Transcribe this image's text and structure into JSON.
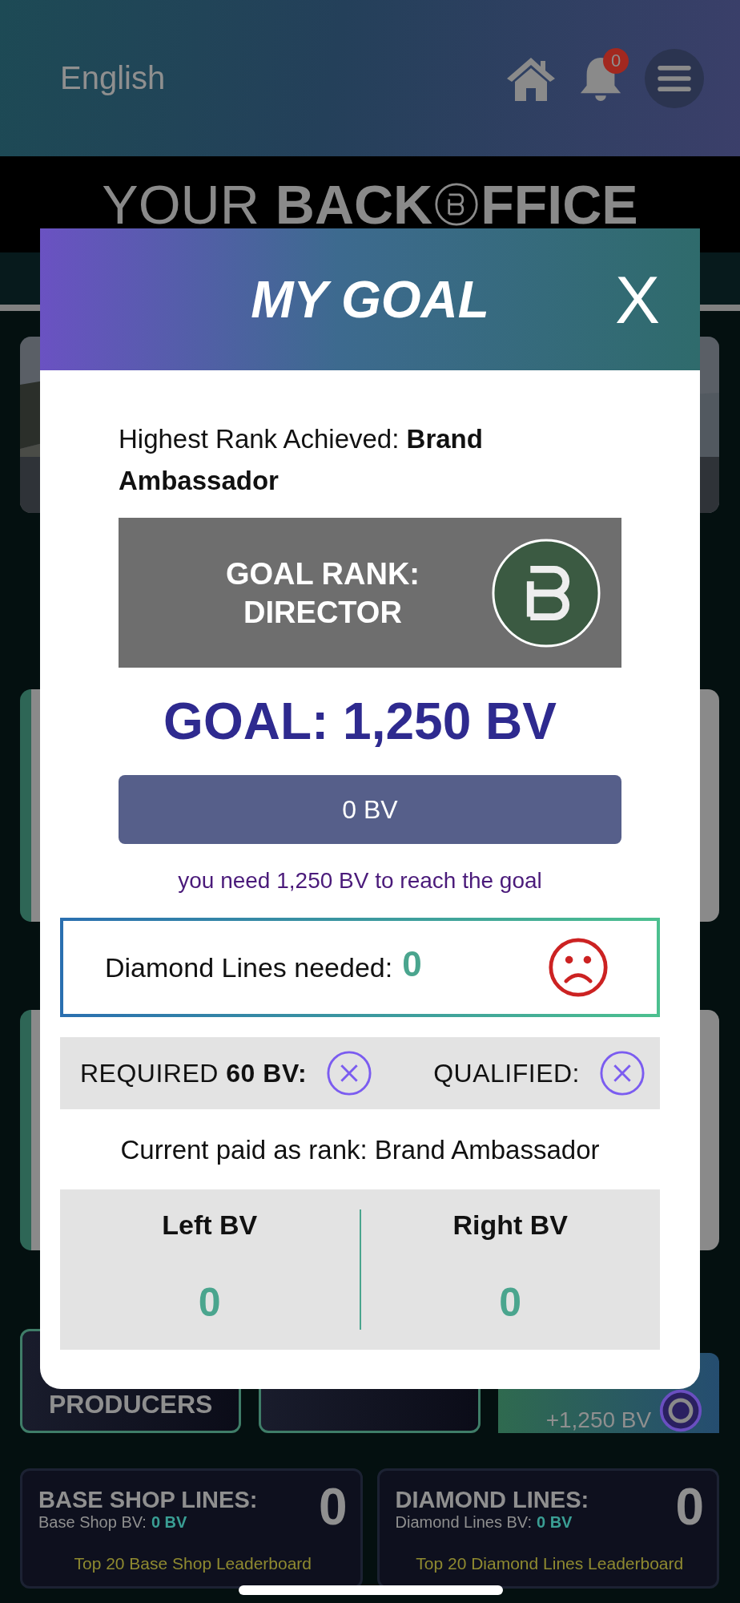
{
  "header": {
    "language": "English",
    "notification_count": "0"
  },
  "banner": {
    "light": "YOUR",
    "bold_left": "BACK",
    "bold_right": "FFICE"
  },
  "tiles": [
    {
      "kind": "outline",
      "label": "PRODUCERS"
    },
    {
      "kind": "outline"
    },
    {
      "kind": "goal",
      "label": "+1,250 BV"
    }
  ],
  "line_cards": [
    {
      "title": "BASE SHOP LINES:",
      "count": "0",
      "bv_label": "Base Shop BV:",
      "bv_value": "0 BV",
      "link": "Top 20 Base Shop Leaderboard"
    },
    {
      "title": "DIAMOND LINES:",
      "count": "0",
      "bv_label": "Diamond Lines BV:",
      "bv_value": "0 BV",
      "link": "Top 20 Diamond Lines Leaderboard"
    }
  ],
  "modal": {
    "title": "MY GOAL",
    "close": "X",
    "highest_rank": "Highest Rank Achieved: **Brand Ambassador**",
    "goal_rank": "GOAL RANK: DIRECTOR",
    "goal": "GOAL: 1,250 BV",
    "progress": {
      "level": 0,
      "label": "0 BV"
    },
    "hint": "you need 1,250 BV to reach the goal",
    "diamond": {
      "label": "Diamond Lines needed:",
      "value": "0",
      "happy": false
    },
    "requirements": [
      {
        "label": "REQUIRED **60 BV:**",
        "met": false
      },
      {
        "label": "QUALIFIED:",
        "met": false
      }
    ],
    "paid_as": "Current paid as rank: Brand Ambassador",
    "legs": [
      {
        "label": "Left BV",
        "value": "0"
      },
      {
        "label": "Right BV",
        "value": "0"
      }
    ]
  }
}
